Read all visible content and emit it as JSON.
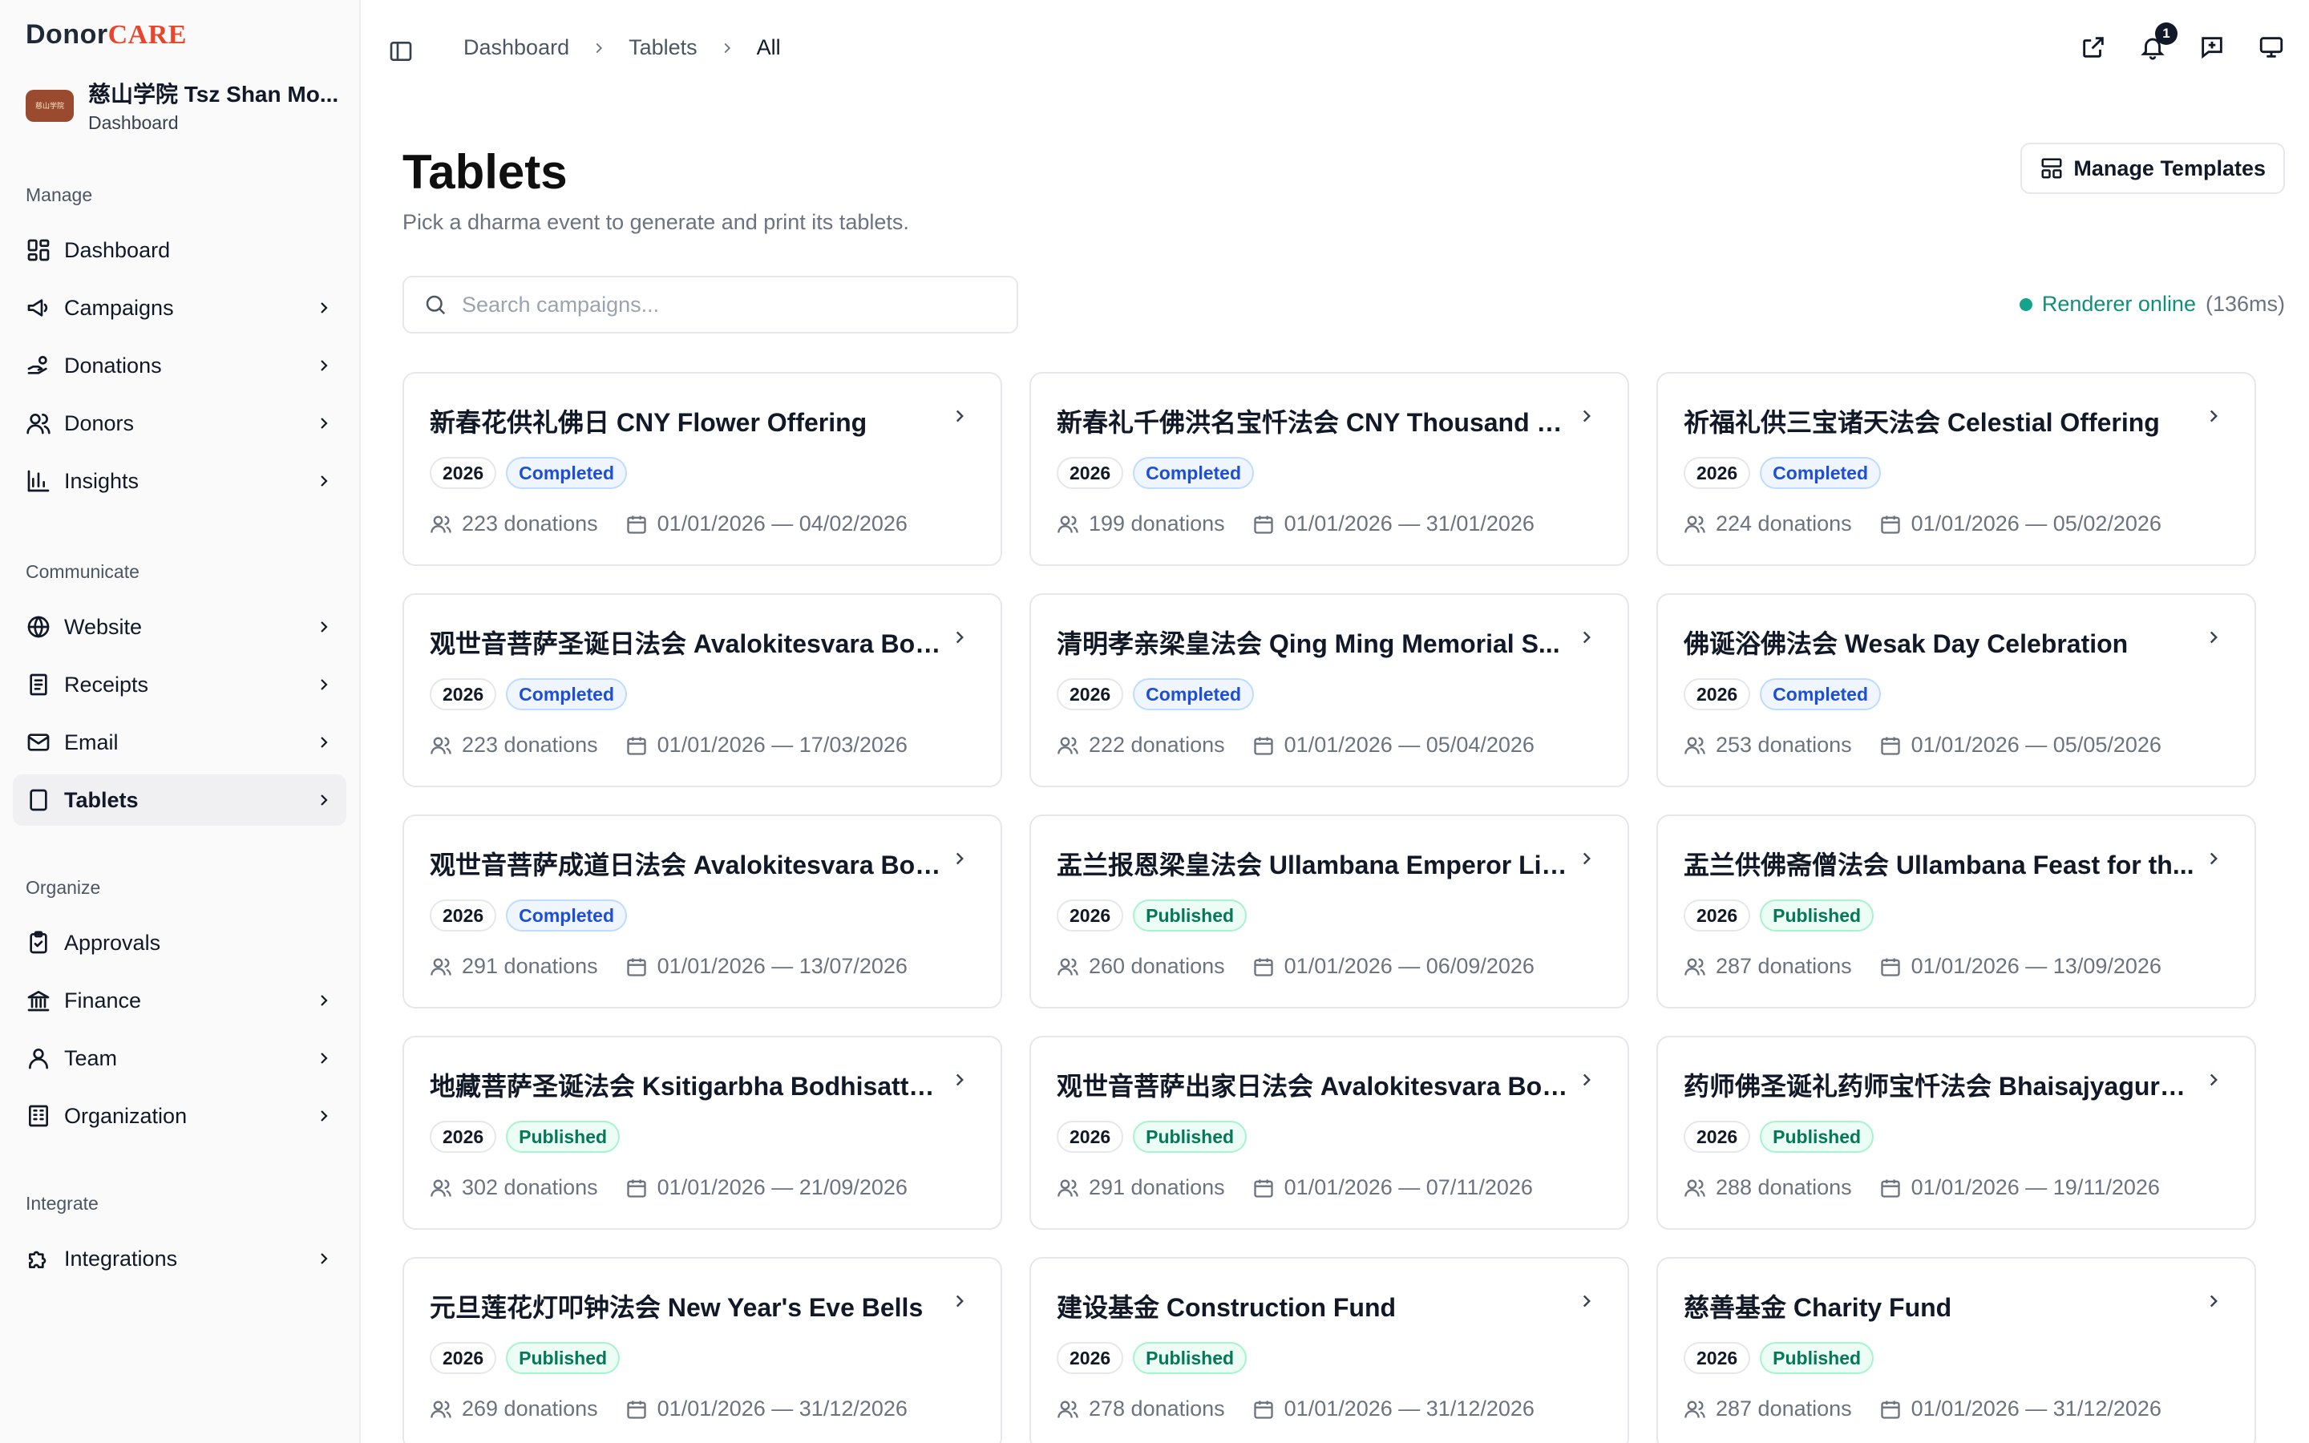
{
  "brand": {
    "part1": "Donor",
    "part2": "CARE"
  },
  "org": {
    "name": "慈山学院 Tsz Shan Mo...",
    "sub": "Dashboard",
    "logo_text": "慈山学院"
  },
  "sidebar": {
    "sections": [
      {
        "heading": "Manage",
        "items": [
          {
            "label": "Dashboard",
            "icon": "dashboard-icon",
            "chevron": false
          },
          {
            "label": "Campaigns",
            "icon": "megaphone-icon",
            "chevron": true
          },
          {
            "label": "Donations",
            "icon": "hand-coins-icon",
            "chevron": true
          },
          {
            "label": "Donors",
            "icon": "users-icon",
            "chevron": true
          },
          {
            "label": "Insights",
            "icon": "bar-chart-icon",
            "chevron": true
          }
        ]
      },
      {
        "heading": "Communicate",
        "items": [
          {
            "label": "Website",
            "icon": "globe-icon",
            "chevron": true
          },
          {
            "label": "Receipts",
            "icon": "receipt-icon",
            "chevron": true
          },
          {
            "label": "Email",
            "icon": "mail-icon",
            "chevron": true
          },
          {
            "label": "Tablets",
            "icon": "tablet-icon",
            "chevron": true,
            "active": true
          }
        ]
      },
      {
        "heading": "Organize",
        "items": [
          {
            "label": "Approvals",
            "icon": "clipboard-check-icon",
            "chevron": false
          },
          {
            "label": "Finance",
            "icon": "bank-icon",
            "chevron": true
          },
          {
            "label": "Team",
            "icon": "user-icon",
            "chevron": true
          },
          {
            "label": "Organization",
            "icon": "building-icon",
            "chevron": true
          }
        ]
      },
      {
        "heading": "Integrate",
        "items": [
          {
            "label": "Integrations",
            "icon": "puzzle-icon",
            "chevron": true
          }
        ]
      }
    ]
  },
  "breadcrumb": {
    "items": [
      "Dashboard",
      "Tablets"
    ],
    "current": "All"
  },
  "notifications": {
    "count": "1"
  },
  "page": {
    "title": "Tablets",
    "subtitle": "Pick a dharma event to generate and print its tablets.",
    "manage_label": "Manage Templates",
    "search_placeholder": "Search campaigns...",
    "renderer_label": "Renderer online",
    "renderer_latency": "(136ms)"
  },
  "campaigns": [
    {
      "title": "新春花供礼佛日 CNY Flower Offering",
      "year": "2026",
      "status": "Completed",
      "donations": "223 donations",
      "dates": "01/01/2026 — 04/02/2026"
    },
    {
      "title": "新春礼千佛洪名宝忏法会 CNY Thousand B...",
      "year": "2026",
      "status": "Completed",
      "donations": "199 donations",
      "dates": "01/01/2026 — 31/01/2026"
    },
    {
      "title": "祈福礼供三宝诸天法会 Celestial Offering",
      "year": "2026",
      "status": "Completed",
      "donations": "224 donations",
      "dates": "01/01/2026 — 05/02/2026"
    },
    {
      "title": "观世音菩萨圣诞日法会 Avalokitesvara Bod...",
      "year": "2026",
      "status": "Completed",
      "donations": "223 donations",
      "dates": "01/01/2026 — 17/03/2026"
    },
    {
      "title": "清明孝亲梁皇法会 Qing Ming Memorial S...",
      "year": "2026",
      "status": "Completed",
      "donations": "222 donations",
      "dates": "01/01/2026 — 05/04/2026"
    },
    {
      "title": "佛诞浴佛法会 Wesak Day Celebration",
      "year": "2026",
      "status": "Completed",
      "donations": "253 donations",
      "dates": "01/01/2026 — 05/05/2026"
    },
    {
      "title": "观世音菩萨成道日法会 Avalokitesvara Boh...",
      "year": "2026",
      "status": "Completed",
      "donations": "291 donations",
      "dates": "01/01/2026 — 13/07/2026"
    },
    {
      "title": "盂兰报恩梁皇法会 Ullambana Emperor Lia...",
      "year": "2026",
      "status": "Published",
      "donations": "260 donations",
      "dates": "01/01/2026 — 06/09/2026"
    },
    {
      "title": "盂兰供佛斋僧法会 Ullambana Feast for th...",
      "year": "2026",
      "status": "Published",
      "donations": "287 donations",
      "dates": "01/01/2026 — 13/09/2026"
    },
    {
      "title": "地藏菩萨圣诞法会 Ksitigarbha Bodhisattva...",
      "year": "2026",
      "status": "Published",
      "donations": "302 donations",
      "dates": "01/01/2026 — 21/09/2026"
    },
    {
      "title": "观世音菩萨出家日法会 Avalokitesvara Bod...",
      "year": "2026",
      "status": "Published",
      "donations": "291 donations",
      "dates": "01/01/2026 — 07/11/2026"
    },
    {
      "title": "药师佛圣诞礼药师宝忏法会 Bhaisajyaguru ...",
      "year": "2026",
      "status": "Published",
      "donations": "288 donations",
      "dates": "01/01/2026 — 19/11/2026"
    },
    {
      "title": "元旦莲花灯叩钟法会 New Year's Eve Bells",
      "year": "2026",
      "status": "Published",
      "donations": "269 donations",
      "dates": "01/01/2026 — 31/12/2026"
    },
    {
      "title": "建设基金 Construction Fund",
      "year": "2026",
      "status": "Published",
      "donations": "278 donations",
      "dates": "01/01/2026 — 31/12/2026"
    },
    {
      "title": "慈善基金 Charity Fund",
      "year": "2026",
      "status": "Published",
      "donations": "287 donations",
      "dates": "01/01/2026 — 31/12/2026"
    }
  ]
}
